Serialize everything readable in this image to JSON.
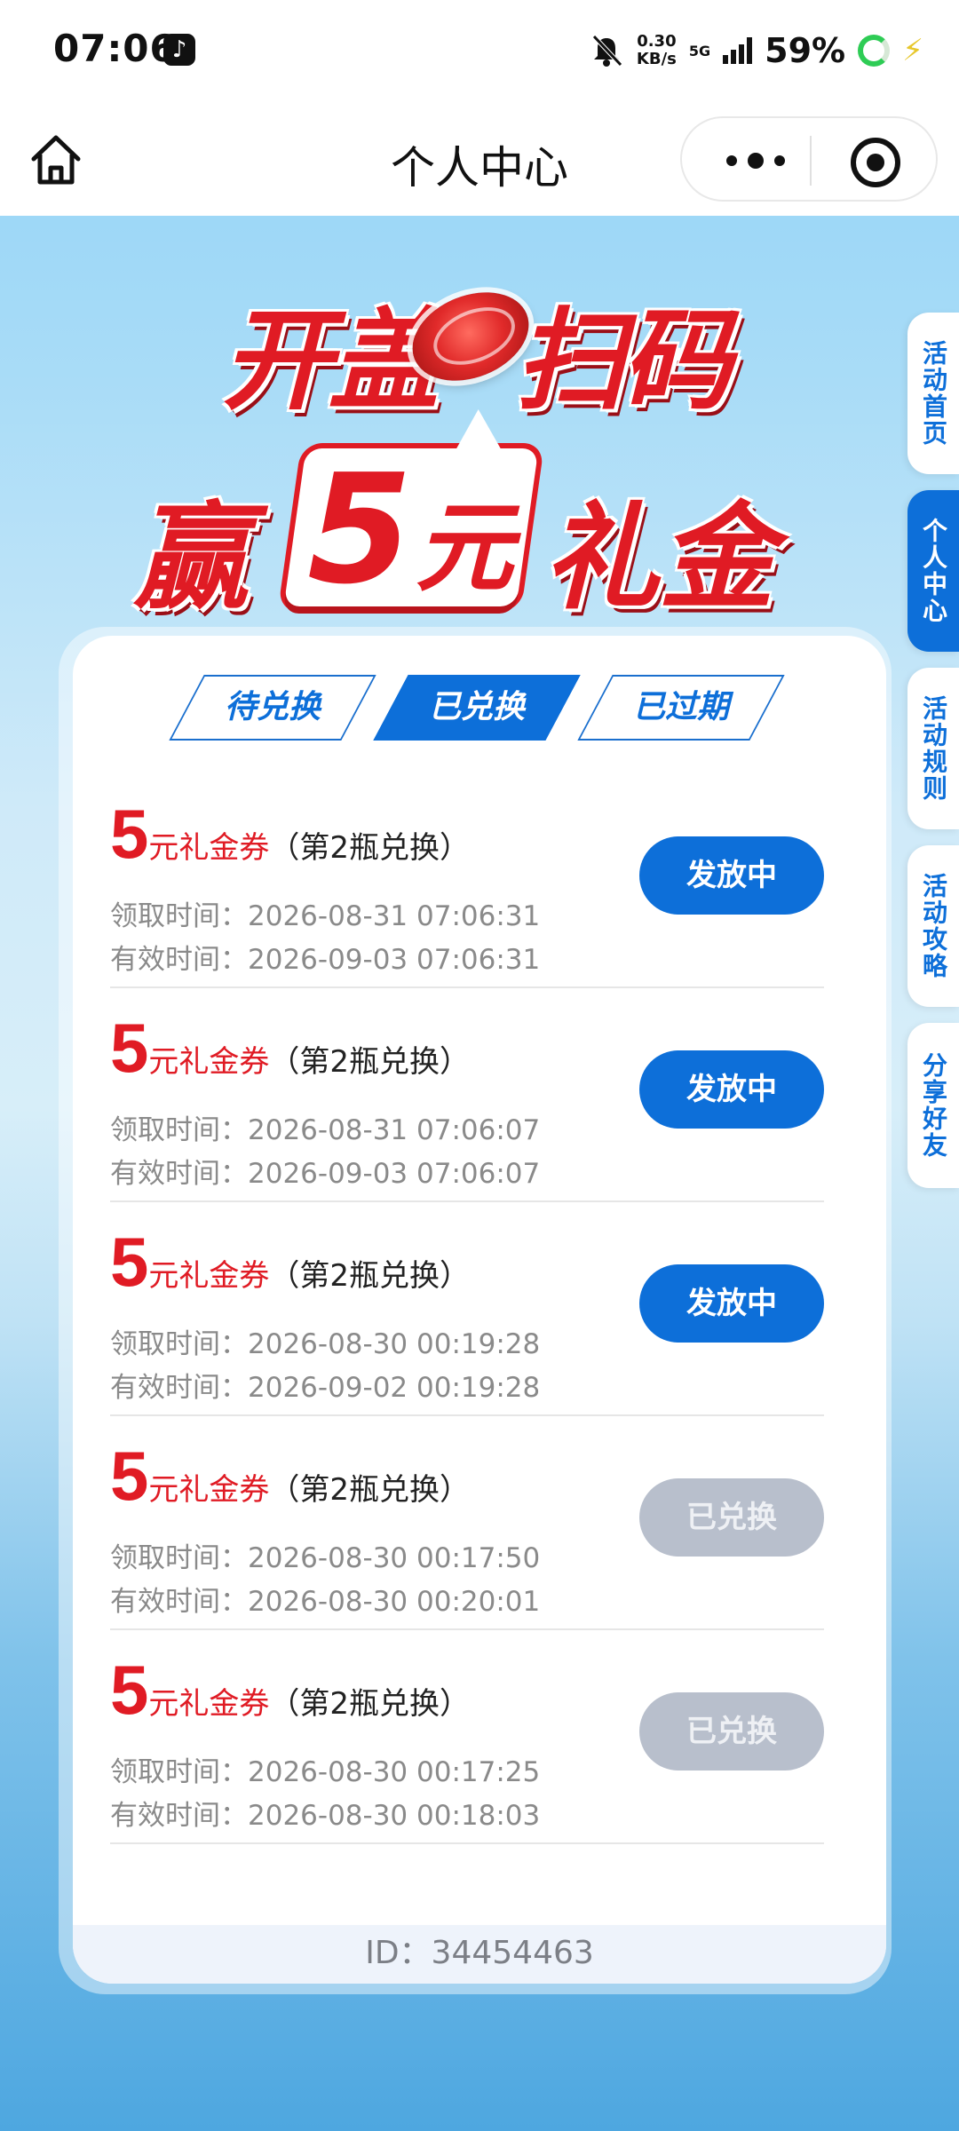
{
  "status_bar": {
    "time": "07:06",
    "speed_value": "0.30",
    "speed_unit": "KB/s",
    "network": "5G",
    "battery": "59%"
  },
  "nav": {
    "title": "个人中心"
  },
  "banner": {
    "line1_left": "开盖",
    "line1_right": "扫码",
    "line2_win": "赢",
    "line2_amount": "5",
    "line2_unit": "元",
    "line2_gift": "礼金"
  },
  "tabs": [
    {
      "label": "待兑换",
      "active": false
    },
    {
      "label": "已兑换",
      "active": true
    },
    {
      "label": "已过期",
      "active": false
    }
  ],
  "coupons": [
    {
      "amount": "5",
      "unit": "元礼金券",
      "subtitle": "（第2瓶兑换）",
      "received": "领取时间：2026-08-31 07:06:31",
      "valid": "有效时间：2026-09-03 07:06:31",
      "status": "发放中"
    },
    {
      "amount": "5",
      "unit": "元礼金券",
      "subtitle": "（第2瓶兑换）",
      "received": "领取时间：2026-08-31 07:06:07",
      "valid": "有效时间：2026-09-03 07:06:07",
      "status": "发放中"
    },
    {
      "amount": "5",
      "unit": "元礼金券",
      "subtitle": "（第2瓶兑换）",
      "received": "领取时间：2026-08-30 00:19:28",
      "valid": "有效时间：2026-09-02 00:19:28",
      "status": "发放中"
    },
    {
      "amount": "5",
      "unit": "元礼金券",
      "subtitle": "（第2瓶兑换）",
      "received": "领取时间：2026-08-30 00:17:50",
      "valid": "有效时间：2026-08-30 00:20:01",
      "status": "已兑换"
    },
    {
      "amount": "5",
      "unit": "元礼金券",
      "subtitle": "（第2瓶兑换）",
      "received": "领取时间：2026-08-30 00:17:25",
      "valid": "有效时间：2026-08-30 00:18:03",
      "status": "已兑换"
    }
  ],
  "footer": {
    "id_text": "ID：34454463"
  },
  "side_tabs": [
    {
      "label": "活动首页",
      "active": false
    },
    {
      "label": "个人中心",
      "active": true
    },
    {
      "label": "活动规则",
      "active": false
    },
    {
      "label": "活动攻略",
      "active": false
    },
    {
      "label": "分享好友",
      "active": false
    }
  ],
  "colors": {
    "accent_blue": "#0d6fd9",
    "brand_red": "#e01b24",
    "disabled_gray": "#b8bfcc"
  }
}
